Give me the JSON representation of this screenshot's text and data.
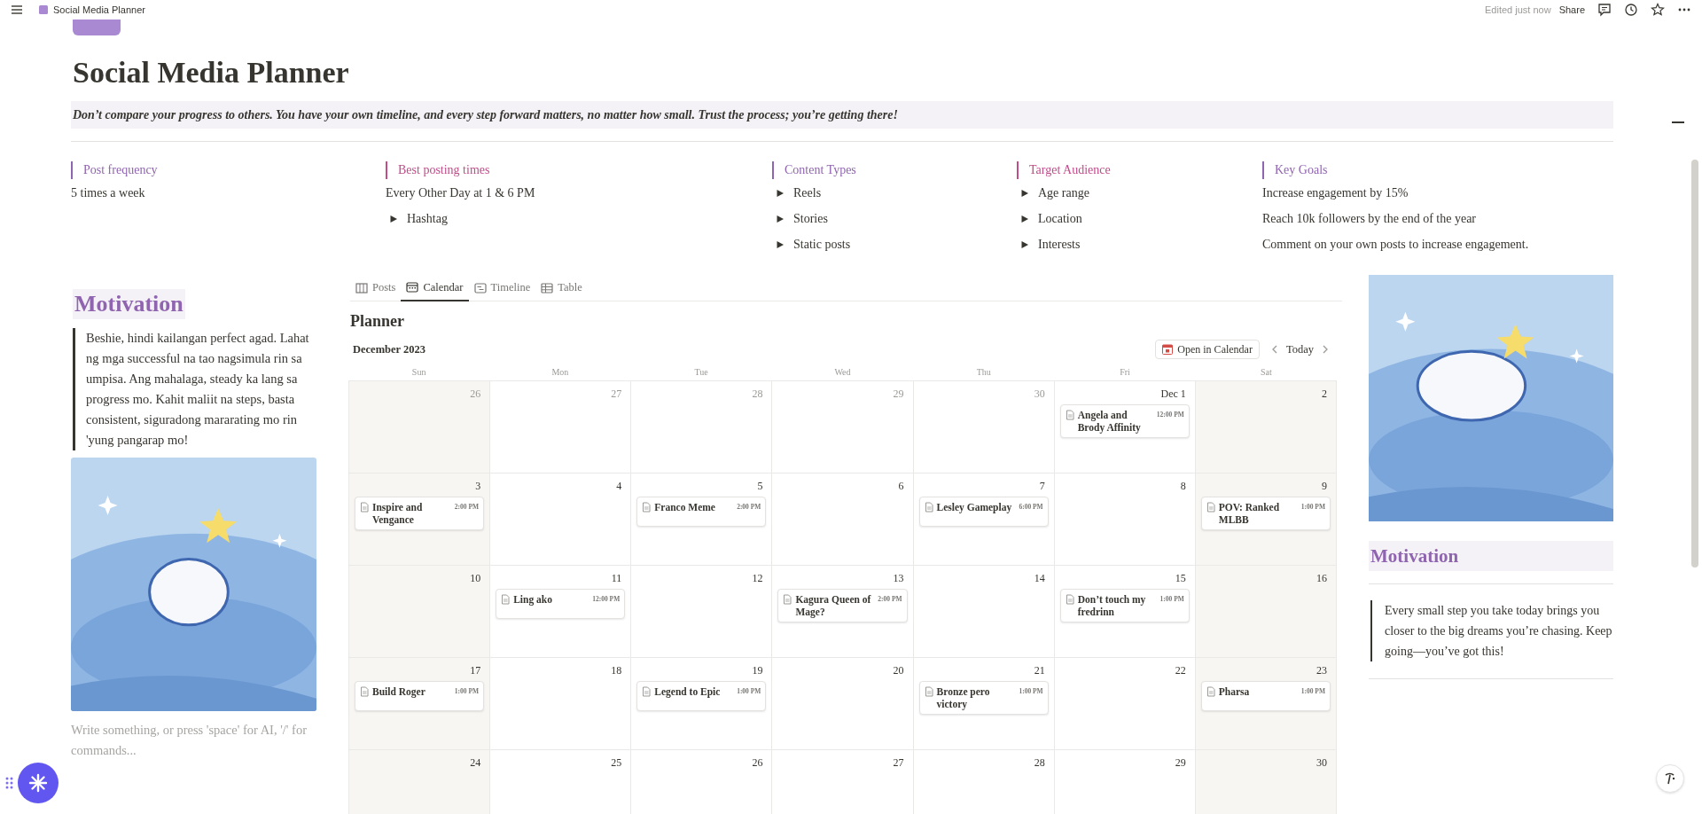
{
  "topbar": {
    "page_title": "Social Media Planner",
    "status": "Edited just now",
    "share": "Share"
  },
  "page": {
    "title": "Social Media Planner",
    "callout": "Don’t compare your progress to others. You have your own timeline, and every step forward matters, no matter how small. Trust the process; you’re getting there!"
  },
  "properties": [
    {
      "heading": "Post frequency",
      "color": "#9065b0",
      "items": [
        {
          "kind": "text",
          "text": "5 times a week"
        }
      ]
    },
    {
      "heading": "Best posting times",
      "color": "#c14c8a",
      "items": [
        {
          "kind": "text",
          "text": "Every Other Day at 1 & 6 PM"
        },
        {
          "kind": "toggle",
          "text": "Hashtag"
        }
      ]
    },
    {
      "heading": "Content Types",
      "color": "#9065b0",
      "items": [
        {
          "kind": "toggle",
          "text": "Reels"
        },
        {
          "kind": "toggle",
          "text": "Stories"
        },
        {
          "kind": "toggle",
          "text": "Static posts"
        }
      ]
    },
    {
      "heading": "Target Audience",
      "color": "#c14c8a",
      "items": [
        {
          "kind": "toggle",
          "text": "Age range"
        },
        {
          "kind": "toggle",
          "text": "Location"
        },
        {
          "kind": "toggle",
          "text": "Interests"
        }
      ]
    },
    {
      "heading": "Key Goals",
      "color": "#9065b0",
      "items": [
        {
          "kind": "text",
          "text": "Increase engagement by 15%"
        },
        {
          "kind": "text",
          "text": "Reach 10k followers by the end of the year"
        },
        {
          "kind": "text",
          "text": "Comment on your own posts to increase engagement."
        }
      ]
    }
  ],
  "left": {
    "heading": "Motivation",
    "quote": "Beshie, hindi kailangan perfect agad. Lahat ng mga successful na tao nagsimula rin sa umpisa. Ang mahalaga, steady ka lang sa progress mo. Kahit maliit na steps, basta consistent, siguradong mararating mo rin 'yung pangarap mo!",
    "placeholder": "Write something, or press 'space' for AI, '/' for commands..."
  },
  "views": {
    "tabs": [
      {
        "kind": "board",
        "label": "Posts",
        "selected": false
      },
      {
        "kind": "calendar",
        "label": "Calendar",
        "selected": true
      },
      {
        "kind": "timeline",
        "label": "Timeline",
        "selected": false
      },
      {
        "kind": "table",
        "label": "Table",
        "selected": false
      }
    ],
    "title": "Planner",
    "month": "December 2023",
    "open_button": "Open in Calendar",
    "today": "Today",
    "weekdays": [
      "Sun",
      "Mon",
      "Tue",
      "Wed",
      "Thu",
      "Fri",
      "Sat"
    ],
    "weeks": [
      [
        {
          "date": "26",
          "muted": true
        },
        {
          "date": "27",
          "muted": true
        },
        {
          "date": "28",
          "muted": true
        },
        {
          "date": "29",
          "muted": true
        },
        {
          "date": "30",
          "muted": true
        },
        {
          "date": "Dec 1",
          "muted": false,
          "events": [
            {
              "title": "Angela and Brody Affinity",
              "time": "12:00 PM"
            }
          ]
        },
        {
          "date": "2",
          "muted": false
        }
      ],
      [
        {
          "date": "3",
          "muted": false,
          "events": [
            {
              "title": "Inspire and Vengance",
              "time": "2:00 PM"
            }
          ]
        },
        {
          "date": "4",
          "muted": false
        },
        {
          "date": "5",
          "muted": false,
          "events": [
            {
              "title": "Franco Meme",
              "time": "2:00 PM"
            }
          ]
        },
        {
          "date": "6",
          "muted": false
        },
        {
          "date": "7",
          "muted": false,
          "events": [
            {
              "title": "Lesley Gameplay",
              "time": "6:00 PM"
            }
          ]
        },
        {
          "date": "8",
          "muted": false
        },
        {
          "date": "9",
          "muted": false,
          "events": [
            {
              "title": "POV: Ranked MLBB",
              "time": "1:00 PM"
            }
          ]
        }
      ],
      [
        {
          "date": "10",
          "muted": false
        },
        {
          "date": "11",
          "muted": false,
          "events": [
            {
              "title": "Ling ako",
              "time": "12:00 PM"
            }
          ]
        },
        {
          "date": "12",
          "muted": false
        },
        {
          "date": "13",
          "muted": false,
          "events": [
            {
              "title": "Kagura Queen of Mage?",
              "time": "2:00 PM"
            }
          ]
        },
        {
          "date": "14",
          "muted": false
        },
        {
          "date": "15",
          "muted": false,
          "events": [
            {
              "title": "Don’t touch my fredrinn",
              "time": "1:00 PM"
            }
          ]
        },
        {
          "date": "16",
          "muted": false
        }
      ],
      [
        {
          "date": "17",
          "muted": false,
          "events": [
            {
              "title": "Build Roger",
              "time": "1:00 PM"
            }
          ]
        },
        {
          "date": "18",
          "muted": false
        },
        {
          "date": "19",
          "muted": false,
          "events": [
            {
              "title": "Legend to Epic",
              "time": "1:00 PM"
            }
          ]
        },
        {
          "date": "20",
          "muted": false
        },
        {
          "date": "21",
          "muted": false,
          "events": [
            {
              "title": "Bronze pero victory",
              "time": "1:00 PM"
            }
          ]
        },
        {
          "date": "22",
          "muted": false
        },
        {
          "date": "23",
          "muted": false,
          "events": [
            {
              "title": "Pharsa",
              "time": "1:00 PM"
            }
          ]
        }
      ],
      [
        {
          "date": "24",
          "muted": false
        },
        {
          "date": "25",
          "muted": false
        },
        {
          "date": "26",
          "muted": false
        },
        {
          "date": "27",
          "muted": false
        },
        {
          "date": "28",
          "muted": false
        },
        {
          "date": "29",
          "muted": false
        },
        {
          "date": "30",
          "muted": false
        }
      ]
    ]
  },
  "right": {
    "heading": "Motivation",
    "quote": "Every small step you take today brings you closer to the big dreams you’re chasing. Keep going—you’ve got this!"
  }
}
